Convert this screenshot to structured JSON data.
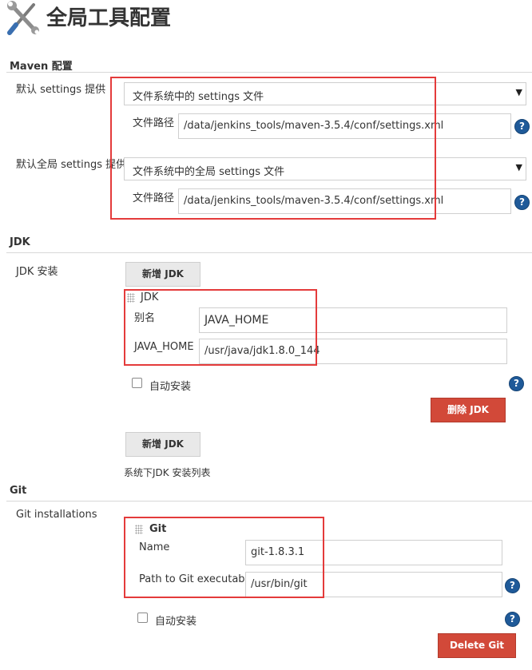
{
  "page_title": "全局工具配置",
  "maven": {
    "section_title": "Maven 配置",
    "settings_label": "默认 settings 提供",
    "settings_select": "文件系统中的 settings 文件",
    "settings_path_label": "文件路径",
    "settings_path_value": "/data/jenkins_tools/maven-3.5.4/conf/settings.xml",
    "global_settings_label": "默认全局 settings 提供",
    "global_settings_select": "文件系统中的全局 settings 文件",
    "global_path_label": "文件路径",
    "global_path_value": "/data/jenkins_tools/maven-3.5.4/conf/settings.xml"
  },
  "jdk": {
    "section_title": "JDK",
    "install_label": "JDK 安装",
    "add_button": "新增 JDK",
    "block_title": "JDK",
    "alias_label": "别名",
    "alias_value": "JAVA_HOME",
    "home_label": "JAVA_HOME",
    "home_value": "/usr/java/jdk1.8.0_144",
    "auto_install_label": "自动安装",
    "delete_button": "删除 JDK",
    "add_button_2": "新增 JDK",
    "list_note": "系统下JDK 安装列表"
  },
  "git": {
    "section_title": "Git",
    "install_label": "Git installations",
    "block_title": "Git",
    "name_label": "Name",
    "name_value": "git-1.8.3.1",
    "path_label": "Path to Git executable",
    "path_value": "/usr/bin/git",
    "auto_install_label": "自动安装",
    "delete_button": "Delete Git"
  },
  "icons": {
    "help": "?",
    "dropdown": "▼",
    "header_icon": "tools-icon"
  },
  "colors": {
    "highlight_border": "#e43b3b",
    "delete_button": "#d24939",
    "help_icon": "#1f5a99"
  }
}
